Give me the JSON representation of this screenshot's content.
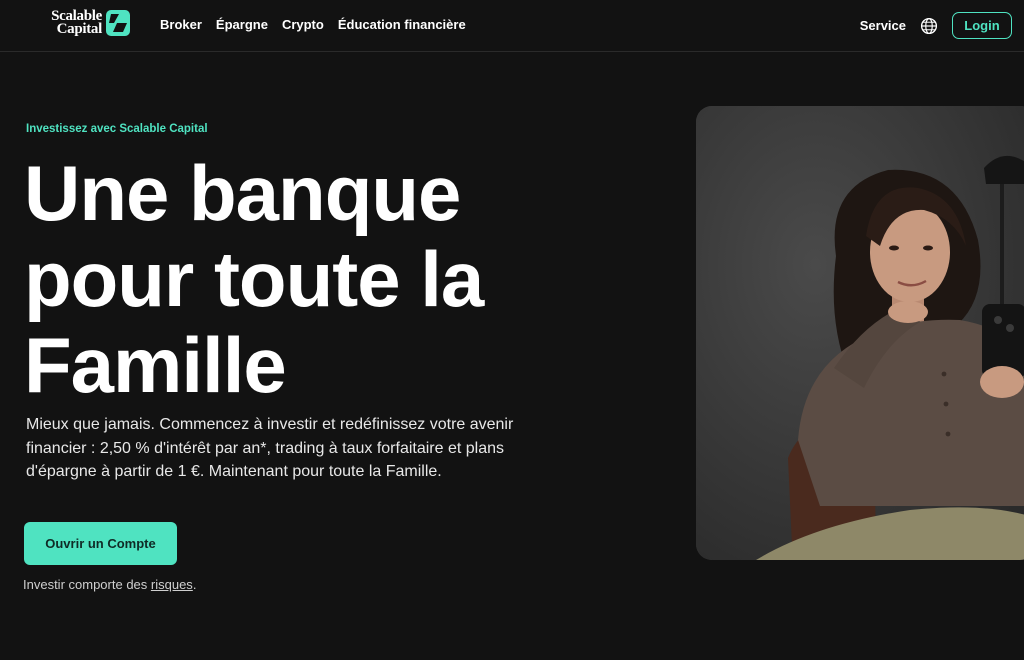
{
  "header": {
    "logo": {
      "line1": "Scalable",
      "line2": "Capital"
    },
    "nav": [
      "Broker",
      "Épargne",
      "Crypto",
      "Éducation financière"
    ],
    "service": "Service",
    "login": "Login"
  },
  "hero": {
    "eyebrow": "Investissez avec Scalable Capital",
    "title_lines": [
      "Une banque",
      "pour toute la",
      "Famille"
    ],
    "description": "Mieux que jamais. Commencez à investir et redéfinissez votre avenir financier : 2,50 % d'intérêt par an*, trading à taux forfaitaire et plans d'épargne à partir de 1 €. Maintenant pour toute la Famille.",
    "cta": "Ouvrir un Compte",
    "risk_prefix": "Investir comporte des ",
    "risk_link": "risques",
    "risk_suffix": "."
  },
  "colors": {
    "background": "#121212",
    "accent": "#4fe3c1",
    "text": "#ffffff"
  },
  "icons": {
    "logo": "scalable-s-logo-icon",
    "language": "globe-icon"
  },
  "image": {
    "subject": "woman with smartphone"
  }
}
